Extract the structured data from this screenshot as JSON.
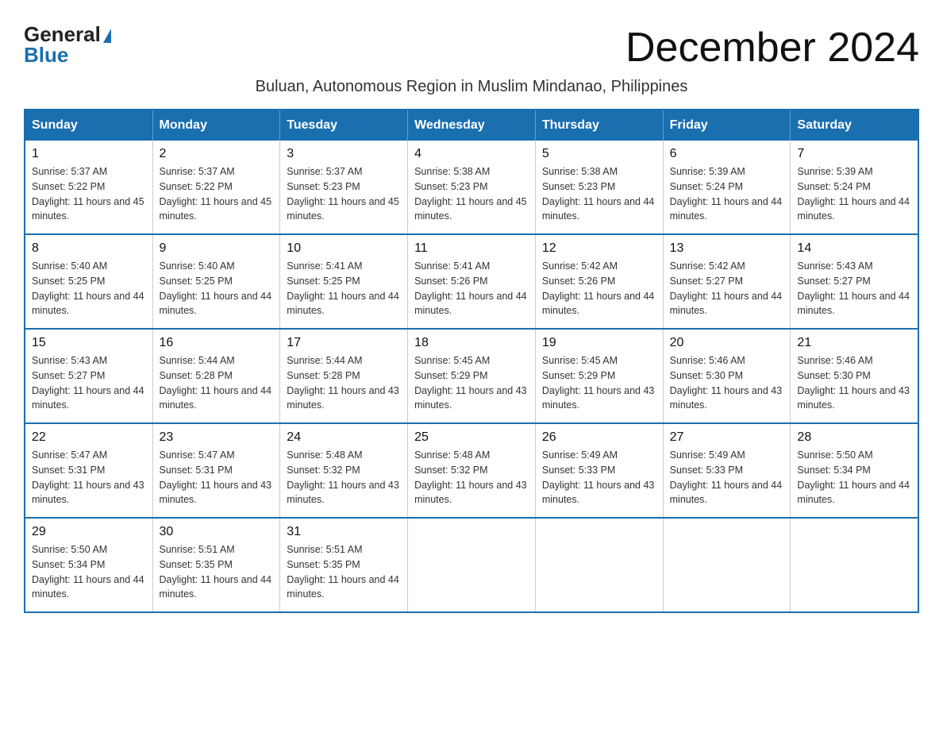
{
  "logo": {
    "general": "General",
    "blue": "Blue"
  },
  "title": "December 2024",
  "subtitle": "Buluan, Autonomous Region in Muslim Mindanao, Philippines",
  "days_of_week": [
    "Sunday",
    "Monday",
    "Tuesday",
    "Wednesday",
    "Thursday",
    "Friday",
    "Saturday"
  ],
  "weeks": [
    [
      {
        "day": "1",
        "sunrise": "5:37 AM",
        "sunset": "5:22 PM",
        "daylight": "11 hours and 45 minutes."
      },
      {
        "day": "2",
        "sunrise": "5:37 AM",
        "sunset": "5:22 PM",
        "daylight": "11 hours and 45 minutes."
      },
      {
        "day": "3",
        "sunrise": "5:37 AM",
        "sunset": "5:23 PM",
        "daylight": "11 hours and 45 minutes."
      },
      {
        "day": "4",
        "sunrise": "5:38 AM",
        "sunset": "5:23 PM",
        "daylight": "11 hours and 45 minutes."
      },
      {
        "day": "5",
        "sunrise": "5:38 AM",
        "sunset": "5:23 PM",
        "daylight": "11 hours and 44 minutes."
      },
      {
        "day": "6",
        "sunrise": "5:39 AM",
        "sunset": "5:24 PM",
        "daylight": "11 hours and 44 minutes."
      },
      {
        "day": "7",
        "sunrise": "5:39 AM",
        "sunset": "5:24 PM",
        "daylight": "11 hours and 44 minutes."
      }
    ],
    [
      {
        "day": "8",
        "sunrise": "5:40 AM",
        "sunset": "5:25 PM",
        "daylight": "11 hours and 44 minutes."
      },
      {
        "day": "9",
        "sunrise": "5:40 AM",
        "sunset": "5:25 PM",
        "daylight": "11 hours and 44 minutes."
      },
      {
        "day": "10",
        "sunrise": "5:41 AM",
        "sunset": "5:25 PM",
        "daylight": "11 hours and 44 minutes."
      },
      {
        "day": "11",
        "sunrise": "5:41 AM",
        "sunset": "5:26 PM",
        "daylight": "11 hours and 44 minutes."
      },
      {
        "day": "12",
        "sunrise": "5:42 AM",
        "sunset": "5:26 PM",
        "daylight": "11 hours and 44 minutes."
      },
      {
        "day": "13",
        "sunrise": "5:42 AM",
        "sunset": "5:27 PM",
        "daylight": "11 hours and 44 minutes."
      },
      {
        "day": "14",
        "sunrise": "5:43 AM",
        "sunset": "5:27 PM",
        "daylight": "11 hours and 44 minutes."
      }
    ],
    [
      {
        "day": "15",
        "sunrise": "5:43 AM",
        "sunset": "5:27 PM",
        "daylight": "11 hours and 44 minutes."
      },
      {
        "day": "16",
        "sunrise": "5:44 AM",
        "sunset": "5:28 PM",
        "daylight": "11 hours and 44 minutes."
      },
      {
        "day": "17",
        "sunrise": "5:44 AM",
        "sunset": "5:28 PM",
        "daylight": "11 hours and 43 minutes."
      },
      {
        "day": "18",
        "sunrise": "5:45 AM",
        "sunset": "5:29 PM",
        "daylight": "11 hours and 43 minutes."
      },
      {
        "day": "19",
        "sunrise": "5:45 AM",
        "sunset": "5:29 PM",
        "daylight": "11 hours and 43 minutes."
      },
      {
        "day": "20",
        "sunrise": "5:46 AM",
        "sunset": "5:30 PM",
        "daylight": "11 hours and 43 minutes."
      },
      {
        "day": "21",
        "sunrise": "5:46 AM",
        "sunset": "5:30 PM",
        "daylight": "11 hours and 43 minutes."
      }
    ],
    [
      {
        "day": "22",
        "sunrise": "5:47 AM",
        "sunset": "5:31 PM",
        "daylight": "11 hours and 43 minutes."
      },
      {
        "day": "23",
        "sunrise": "5:47 AM",
        "sunset": "5:31 PM",
        "daylight": "11 hours and 43 minutes."
      },
      {
        "day": "24",
        "sunrise": "5:48 AM",
        "sunset": "5:32 PM",
        "daylight": "11 hours and 43 minutes."
      },
      {
        "day": "25",
        "sunrise": "5:48 AM",
        "sunset": "5:32 PM",
        "daylight": "11 hours and 43 minutes."
      },
      {
        "day": "26",
        "sunrise": "5:49 AM",
        "sunset": "5:33 PM",
        "daylight": "11 hours and 43 minutes."
      },
      {
        "day": "27",
        "sunrise": "5:49 AM",
        "sunset": "5:33 PM",
        "daylight": "11 hours and 44 minutes."
      },
      {
        "day": "28",
        "sunrise": "5:50 AM",
        "sunset": "5:34 PM",
        "daylight": "11 hours and 44 minutes."
      }
    ],
    [
      {
        "day": "29",
        "sunrise": "5:50 AM",
        "sunset": "5:34 PM",
        "daylight": "11 hours and 44 minutes."
      },
      {
        "day": "30",
        "sunrise": "5:51 AM",
        "sunset": "5:35 PM",
        "daylight": "11 hours and 44 minutes."
      },
      {
        "day": "31",
        "sunrise": "5:51 AM",
        "sunset": "5:35 PM",
        "daylight": "11 hours and 44 minutes."
      },
      null,
      null,
      null,
      null
    ]
  ]
}
